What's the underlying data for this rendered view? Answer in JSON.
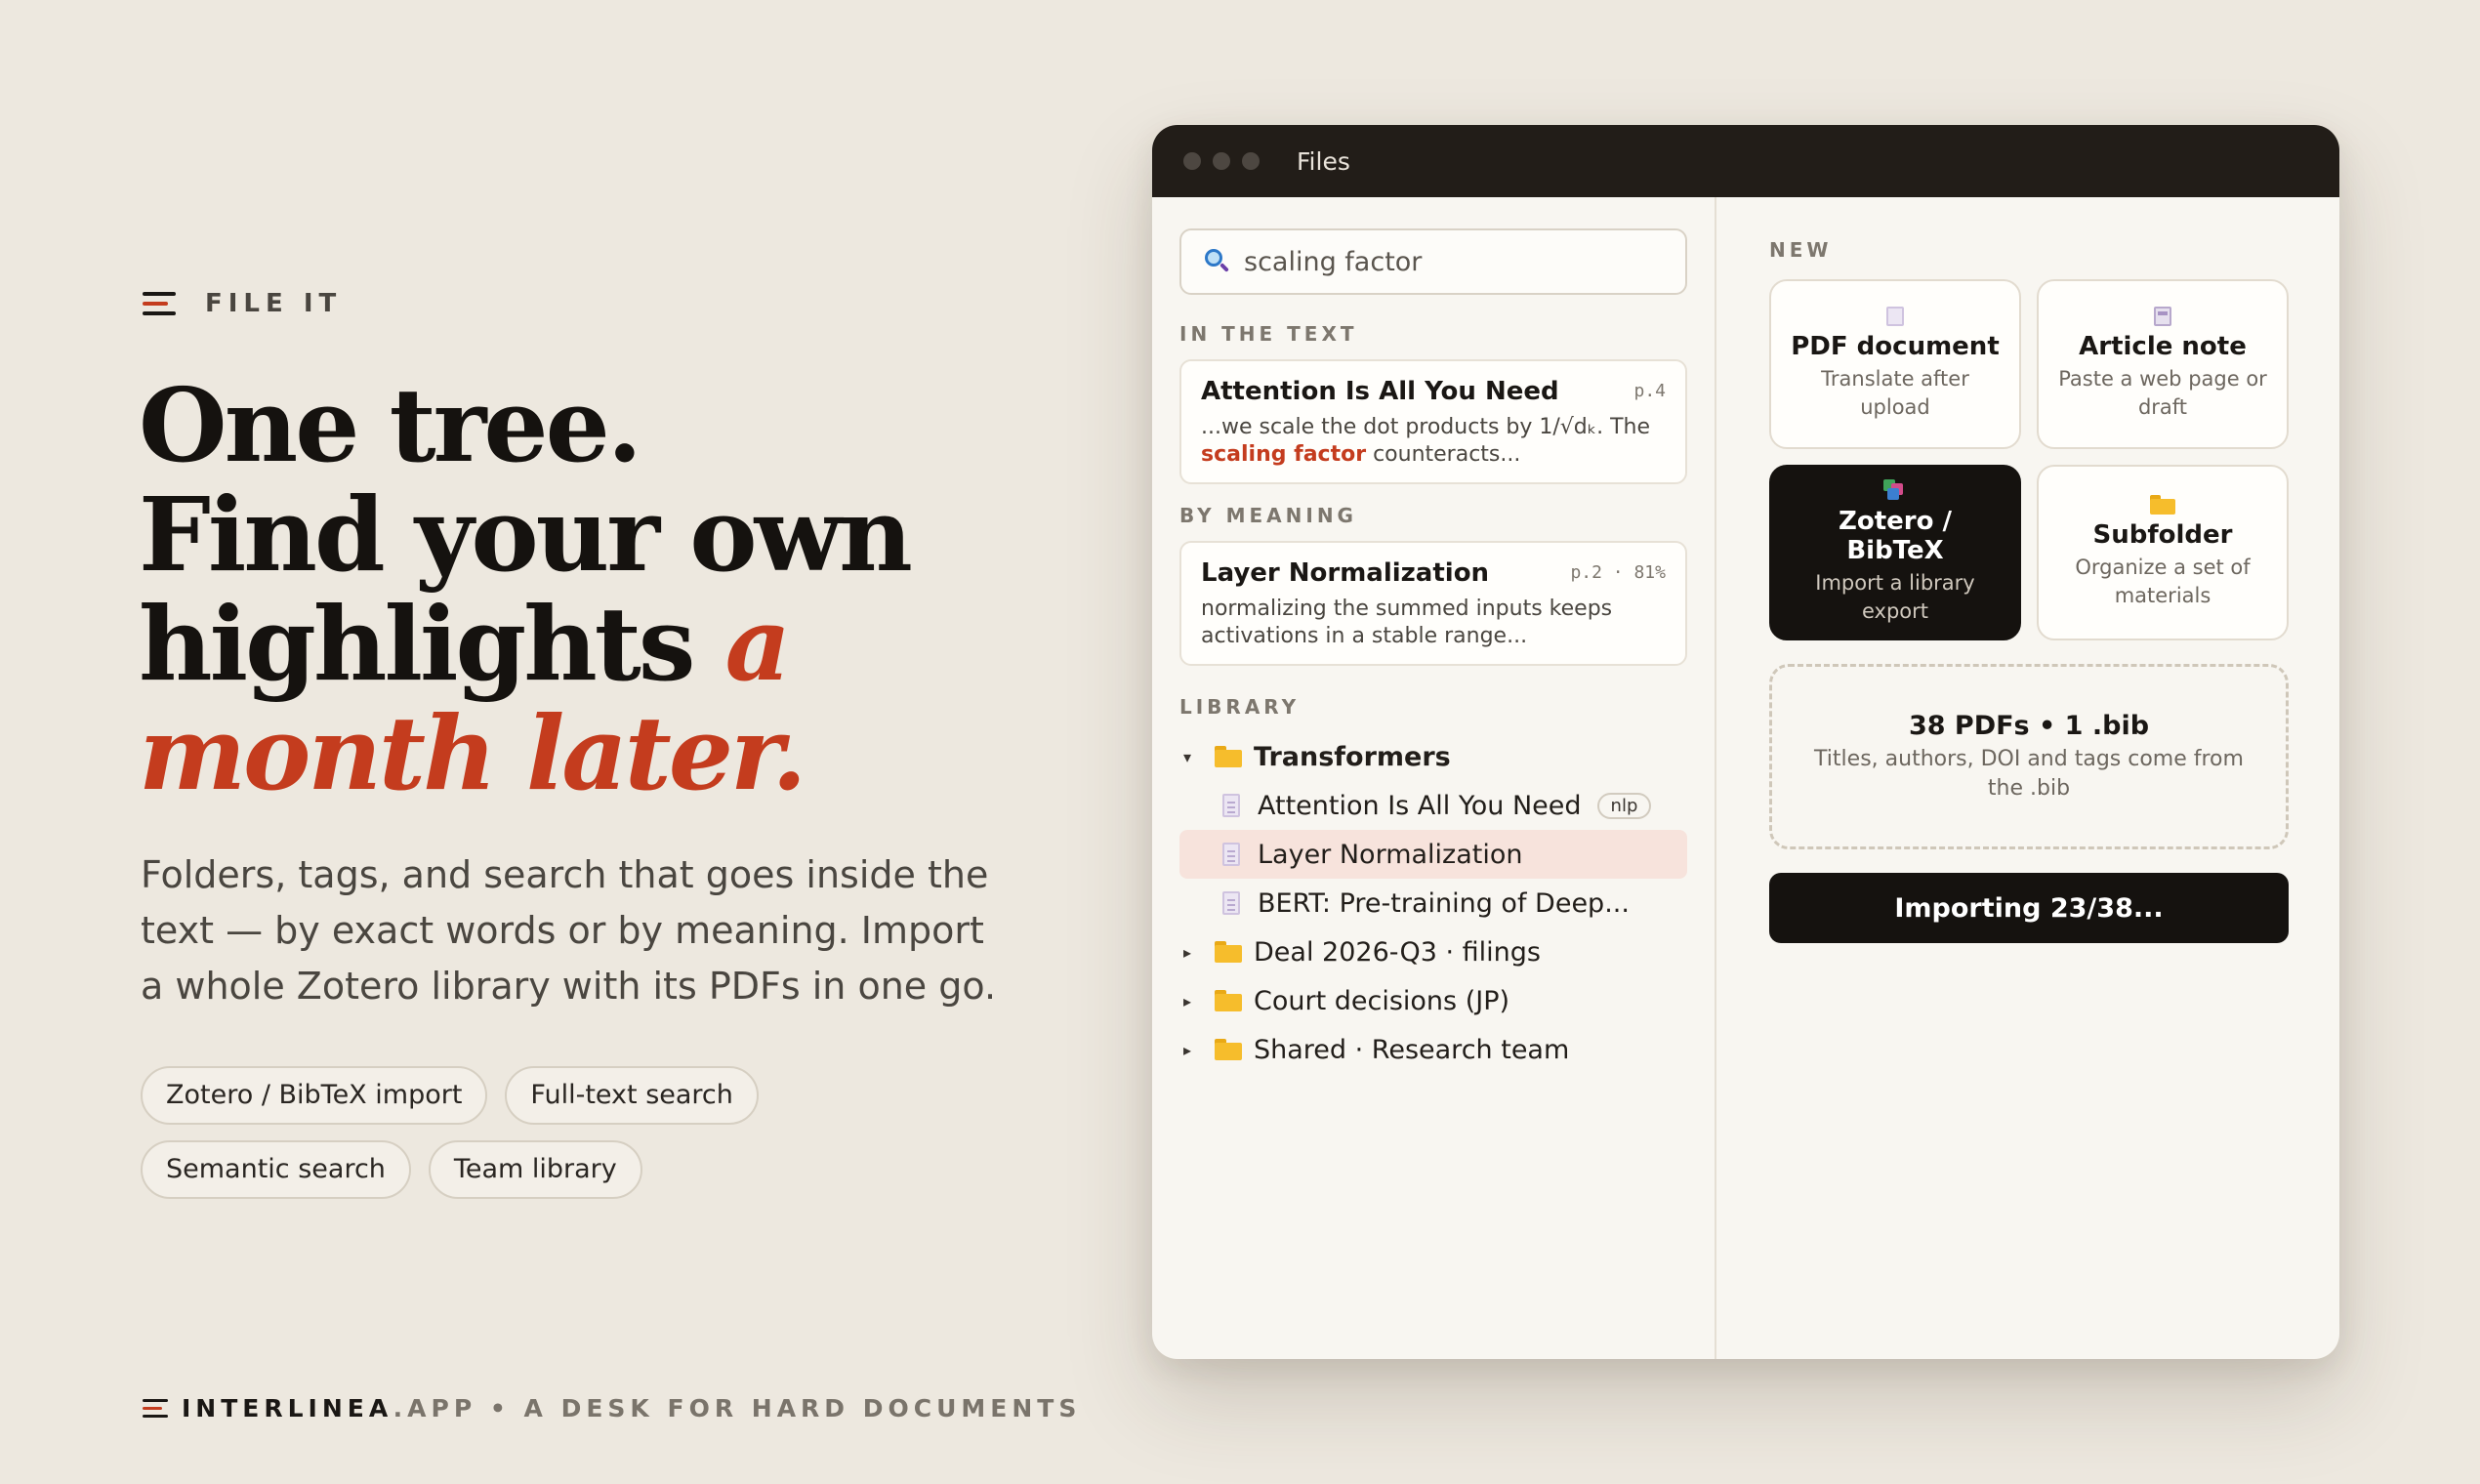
{
  "brand": {
    "name": "FILE IT"
  },
  "hero": {
    "line1": "One tree.",
    "line2": "Find your own",
    "line3": "highlights",
    "accent1": "a",
    "accent2": "month later.",
    "lede": "Folders, tags, and search that goes inside the text — by exact words or by meaning. Import a whole Zotero library with its PDFs in one go.",
    "chips": [
      "Zotero / BibTeX import",
      "Full-text search",
      "Semantic search",
      "Team library"
    ]
  },
  "footer": {
    "domain": "INTERLINEA",
    "tld": ".APP",
    "tagline": " • A DESK FOR HARD DOCUMENTS"
  },
  "window": {
    "title": "Files",
    "search": {
      "value": "scaling factor"
    },
    "in_text": {
      "label": "IN THE TEXT",
      "title": "Attention Is All You Need",
      "meta": "p.4",
      "snippet_before": "...we scale the dot products by 1/√dₖ. The ",
      "snippet_highlight": "scaling factor",
      "snippet_after": " counteracts..."
    },
    "by_meaning": {
      "label": "BY MEANING",
      "title": "Layer Normalization",
      "meta": "p.2 · 81%",
      "snippet": "normalizing the summed inputs keeps activations in a stable range..."
    },
    "library": {
      "label": "LIBRARY",
      "root": "Transformers",
      "docs": [
        "Attention Is All You Need",
        "Layer Normalization",
        "BERT: Pre-training of Deep..."
      ],
      "doc_tag": "nlp",
      "folders": [
        "Deal 2026-Q3 · filings",
        "Court decisions (JP)",
        "Shared · Research team"
      ]
    },
    "new": {
      "label": "NEW",
      "tiles": [
        {
          "title": "PDF document",
          "sub": "Translate after upload",
          "icon": "pdf-doc-icon"
        },
        {
          "title": "Article note",
          "sub": "Paste a web page or draft",
          "icon": "note-icon"
        },
        {
          "title": "Zotero / BibTeX",
          "sub": "Import a library export",
          "icon": "zotero-icon"
        },
        {
          "title": "Subfolder",
          "sub": "Organize a set of materials",
          "icon": "folder-icon"
        }
      ],
      "dropzone": {
        "title": "38 PDFs • 1 .bib",
        "sub": "Titles, authors, DOI and tags come from the .bib"
      },
      "import_button": "Importing 23/38..."
    }
  },
  "colors": {
    "accent": "#c43c1e",
    "background": "#ede8df",
    "titlebar": "#221d18",
    "dark_tile": "#15120f"
  }
}
